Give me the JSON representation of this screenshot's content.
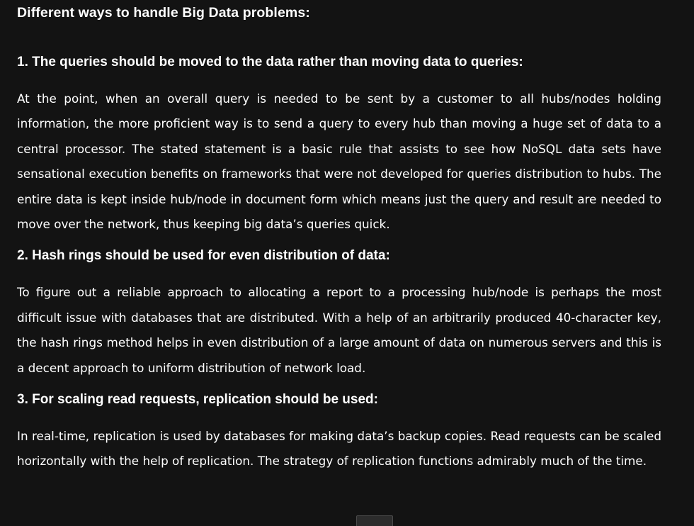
{
  "article": {
    "title": "Different ways to handle Big Data problems:",
    "sections": [
      {
        "heading": "1. The queries should be moved to the data rather than moving data to queries:",
        "body": "At the point, when an overall query is needed to be sent by a customer to all hubs/nodes holding information, the more proficient way is to send a query to every hub than moving a huge set of data to a central processor. The stated statement is a basic rule that assists to see how NoSQL data sets have sensational execution benefits on frameworks that were not developed for queries distribution to hubs. The entire data is kept inside hub/node in document form which means just the query and result are needed to move over the network, thus keeping big data’s queries quick."
      },
      {
        "heading": "2. Hash rings should be used for even distribution of data:",
        "body": "To figure out a reliable approach to allocating a report to a processing hub/node is perhaps the most difficult issue with databases that are distributed. With a help of an arbitrarily produced 40-character key, the hash rings method helps in even distribution of a large amount of data on numerous servers and this is a decent approach to uniform distribution of network load."
      },
      {
        "heading": "3. For scaling read requests, replication should be used:",
        "body": "In real-time, replication is used by databases for making data’s backup copies. Read requests can be scaled horizontally with the help of replication. The strategy of replication functions admirably much of the time."
      }
    ]
  }
}
